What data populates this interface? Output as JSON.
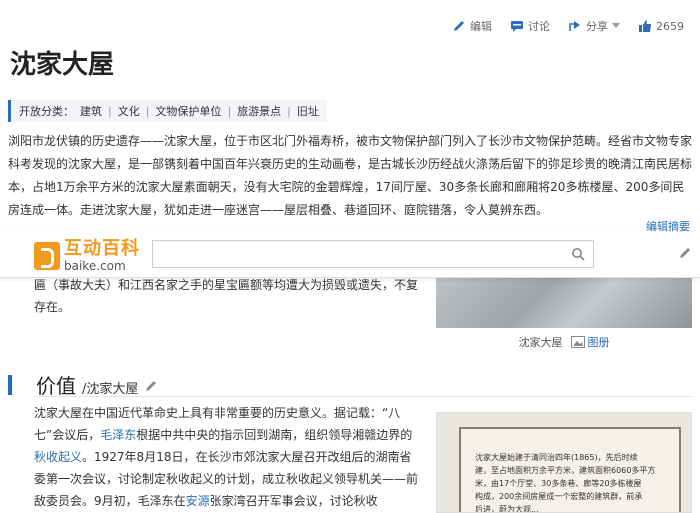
{
  "toolbar": {
    "edit_label": "编辑",
    "discuss_label": "讨论",
    "share_label": "分享",
    "like_count": "2659"
  },
  "title": "沈家大屋",
  "categories": {
    "label": "开放分类：",
    "items": [
      "建筑",
      "文化",
      "文物保护单位",
      "旅游景点",
      "旧址"
    ]
  },
  "intro": "浏阳市龙伏镇的历史遗存——沈家大屋，位于市区北门外福寿桥，被市文物保护部门列入了长沙市文物保护范畴。经省市文物专家科考发现的沈家大屋，是一部镌刻着中国百年兴衰历史的生动画卷，是古城长沙历经战火涤荡后留下的弥足珍贵的晚清江南民居标本，占地1万余平方米的沈家大屋素面朝天，没有大宅院的金碧辉煌，17间厅屋、30多条长廊和廊厢将20多栋楼屋、200多间民房连成一体。走进沈家大屋，犹如走进一座迷宫——屋层相叠、巷道回环、庭院错落，令人莫辨东西。",
  "edit_summary": "编辑摘要",
  "header": {
    "logo_cn": "互动百科",
    "logo_en": "baike.com",
    "search_placeholder": ""
  },
  "para0": "匾（事故大夫）和江西名家之手的星宝匾额等均遭大为损毁或遗失，不复存在。",
  "img1": {
    "caption": "沈家大屋",
    "gallery_label": "图册"
  },
  "section": {
    "title": "价值",
    "subtitle": "/沈家大屋"
  },
  "para1": {
    "t1": "沈家大屋在中国近代革命史上具有非常重要的历史意义。据记载：“八七”会议后，",
    "link1": "毛泽东",
    "t2": "根据中共中央的指示回到湖南，组织领导湘赣边界的",
    "link2": "秋收起义",
    "t3": "。1927年8月18日，在长沙市郊沈家大屋召开改组后的湖南省委第一次会议，讨论制定秋收起义的计划，成立秋收起义领导机关——前敌委员会。9月初，毛泽东在",
    "link3": "安源",
    "t4": "张家湾召开军事会议，讨论秋收"
  },
  "plaque_lines": [
    "沈家大屋始建于清同治四年(1865)，先后时续",
    "建，至占地面积万余平方米，建筑面积6060多平方",
    "米，由17个厅堂、30多条巷、廊等20多栋楼屋",
    "构成，200余间房屋成一个宏整的建筑群，前承",
    "后进，蔚为大观..."
  ]
}
